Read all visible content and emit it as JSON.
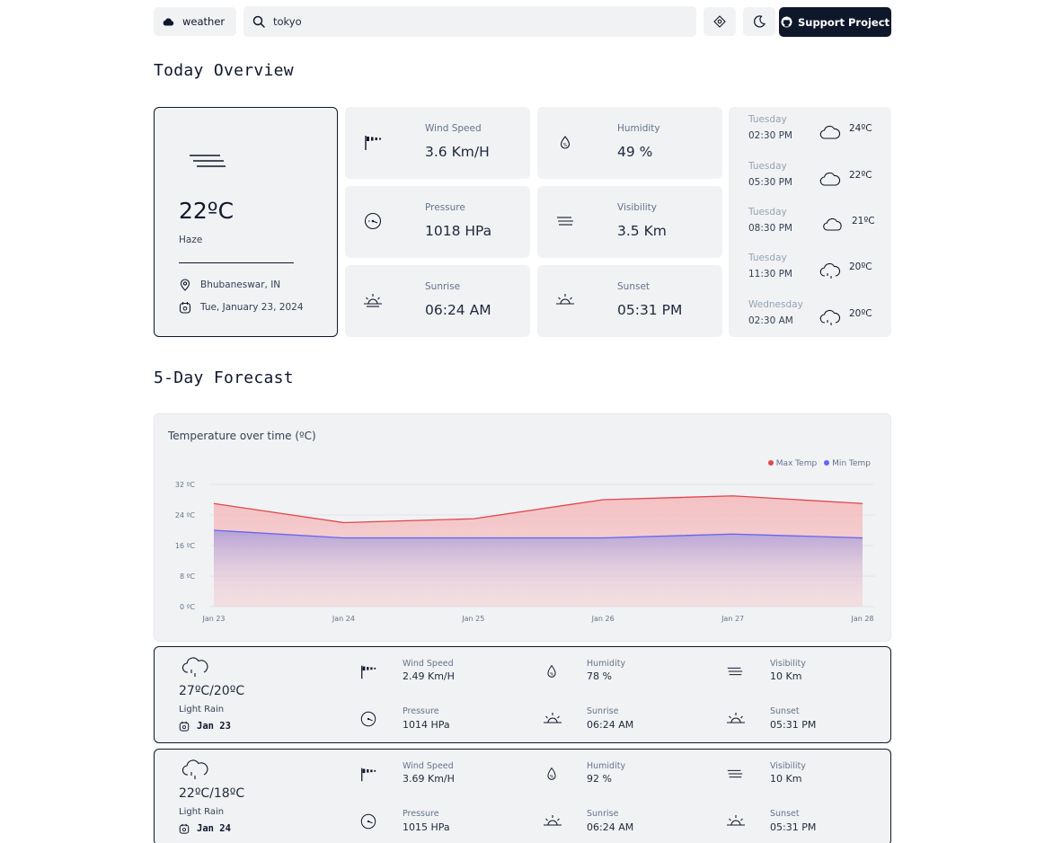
{
  "header": {
    "brand_label": "weather",
    "search_value": "tokyo",
    "support_label": "Support Project"
  },
  "today": {
    "section_title": "Today Overview",
    "current": {
      "temp": "22ºC",
      "condition": "Haze",
      "location": "Bhubaneswar, IN",
      "date": "Tue, January 23, 2024"
    },
    "stats": [
      {
        "label": "Wind Speed",
        "value": "3.6 Km/H",
        "icon": "wind-icon"
      },
      {
        "label": "Humidity",
        "value": "49 %",
        "icon": "humidity-icon"
      },
      {
        "label": "Pressure",
        "value": "1018 HPa",
        "icon": "pressure-icon"
      },
      {
        "label": "Visibility",
        "value": "3.5 Km",
        "icon": "visibility-icon"
      },
      {
        "label": "Sunrise",
        "value": "06:24 AM",
        "icon": "sunrise-icon"
      },
      {
        "label": "Sunset",
        "value": "05:31 PM",
        "icon": "sunset-icon"
      }
    ],
    "hourly": [
      {
        "day": "Tuesday",
        "time": "02:30 PM",
        "temp": "24ºC",
        "icon": "cloud-icon"
      },
      {
        "day": "Tuesday",
        "time": "05:30 PM",
        "temp": "22ºC",
        "icon": "cloud-icon"
      },
      {
        "day": "Tuesday",
        "time": "08:30 PM",
        "temp": "21ºC",
        "icon": "cloud-icon"
      },
      {
        "day": "Tuesday",
        "time": "11:30 PM",
        "temp": "20ºC",
        "icon": "rain-cloud-icon"
      },
      {
        "day": "Wednesday",
        "time": "02:30 AM",
        "temp": "20ºC",
        "icon": "rain-cloud-icon"
      }
    ]
  },
  "forecast": {
    "section_title": "5-Day Forecast",
    "days": [
      {
        "temp": "27ºC/20ºC",
        "condition": "Light Rain",
        "date": "Jan 23",
        "wind_label": "Wind Speed",
        "wind": "2.49 Km/H",
        "humidity_label": "Humidity",
        "humidity": "78 %",
        "visibility_label": "Visibility",
        "visibility": "10 Km",
        "pressure_label": "Pressure",
        "pressure": "1014 HPa",
        "sunrise_label": "Sunrise",
        "sunrise": "06:24 AM",
        "sunset_label": "Sunset",
        "sunset": "05:31 PM"
      },
      {
        "temp": "22ºC/18ºC",
        "condition": "Light Rain",
        "date": "Jan 24",
        "wind_label": "Wind Speed",
        "wind": "3.69 Km/H",
        "humidity_label": "Humidity",
        "humidity": "92 %",
        "visibility_label": "Visibility",
        "visibility": "10 Km",
        "pressure_label": "Pressure",
        "pressure": "1015 HPa",
        "sunrise_label": "Sunrise",
        "sunrise": "06:24 AM",
        "sunset_label": "Sunset",
        "sunset": "05:31 PM"
      }
    ]
  },
  "chart_data": {
    "type": "area",
    "title": "Temperature over time (ºC)",
    "categories": [
      "Jan 23",
      "Jan 24",
      "Jan 25",
      "Jan 26",
      "Jan 27",
      "Jan 28"
    ],
    "series": [
      {
        "name": "Max Temp",
        "values": [
          27,
          22,
          23,
          28,
          29,
          27
        ],
        "color": "#e0474c"
      },
      {
        "name": "Min Temp",
        "values": [
          20,
          18,
          18,
          18,
          19,
          18
        ],
        "color": "#6366f1"
      }
    ],
    "y_ticks": [
      "0 ºC",
      "8 ºC",
      "16 ºC",
      "24 ºC",
      "32 ºC"
    ],
    "ylim": [
      0,
      32
    ],
    "grid": true,
    "legend": "top-right"
  }
}
